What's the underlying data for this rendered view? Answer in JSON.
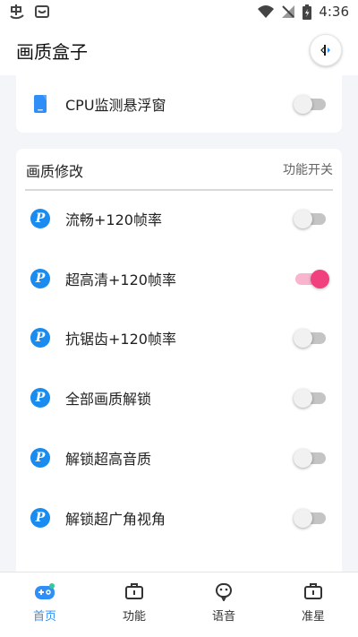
{
  "status_bar": {
    "time": "4:36"
  },
  "app": {
    "title": "画质盒子"
  },
  "cpu_card": {
    "label": "CPU监测悬浮窗",
    "enabled": false
  },
  "section": {
    "title": "画质修改",
    "right_label": "功能开关",
    "items": [
      {
        "label": "流畅+120帧率",
        "enabled": false
      },
      {
        "label": "超高清+120帧率",
        "enabled": true
      },
      {
        "label": "抗锯齿+120帧率",
        "enabled": false
      },
      {
        "label": "全部画质解锁",
        "enabled": false
      },
      {
        "label": "解锁超高音质",
        "enabled": false
      },
      {
        "label": "解锁超广角视角",
        "enabled": false
      }
    ]
  },
  "tabs": [
    {
      "label": "首页",
      "icon": "gamepad-icon",
      "active": true
    },
    {
      "label": "功能",
      "icon": "toolbox-icon",
      "active": false
    },
    {
      "label": "语音",
      "icon": "face-icon",
      "active": false
    },
    {
      "label": "准星",
      "icon": "crosshair-box-icon",
      "active": false
    }
  ],
  "colors": {
    "accent_pink": "#f0407d",
    "accent_blue": "#2f8ff6"
  }
}
